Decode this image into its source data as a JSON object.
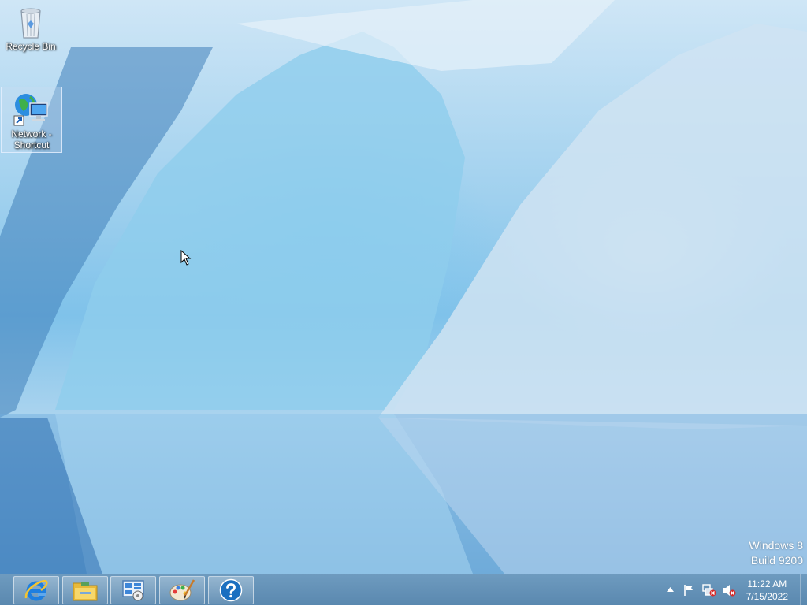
{
  "desktop": {
    "icons": [
      {
        "label": "Recycle Bin",
        "icon": "recycle-bin-icon"
      },
      {
        "label": "Network - Shortcut",
        "icon": "network-shortcut-icon"
      }
    ],
    "watermark": {
      "line1": "Windows 8",
      "line2": "Build 9200"
    }
  },
  "taskbar": {
    "pinned": [
      {
        "name": "Internet Explorer",
        "icon": "internet-explorer-icon"
      },
      {
        "name": "File Explorer",
        "icon": "file-explorer-icon"
      },
      {
        "name": "Control Panel",
        "icon": "control-panel-icon"
      },
      {
        "name": "Paint",
        "icon": "paint-icon"
      },
      {
        "name": "Help and Support",
        "icon": "help-icon"
      }
    ],
    "tray": {
      "icons": [
        "chevron-up-icon",
        "action-center-flag-icon",
        "network-disconnected-icon",
        "volume-muted-icon"
      ]
    },
    "clock": {
      "time": "11:22 AM",
      "date": "7/15/2022"
    }
  },
  "colors": {
    "taskbar": "#5f8db3",
    "accent": "#1e6fc0"
  }
}
